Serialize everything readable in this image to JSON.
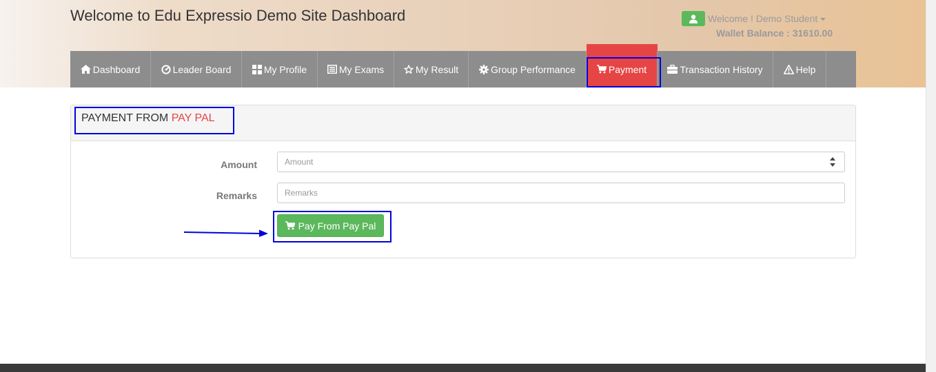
{
  "header": {
    "title": "Welcome to Edu Expressio Demo Site Dashboard",
    "welcome": "Welcome ! Demo Student",
    "wallet": "Wallet Balance : 31610.00"
  },
  "nav": {
    "items": [
      {
        "label": "Dashboard",
        "icon": "home-icon"
      },
      {
        "label": "Leader Board",
        "icon": "dashboard-gauge-icon"
      },
      {
        "label": "My Profile",
        "icon": "grid-icon"
      },
      {
        "label": "My Exams",
        "icon": "list-icon"
      },
      {
        "label": "My Result",
        "icon": "star-icon"
      },
      {
        "label": "Group Performance",
        "icon": "gear-icon"
      },
      {
        "label": "Payment",
        "icon": "cart-icon",
        "active": true
      },
      {
        "label": "Transaction History",
        "icon": "briefcase-icon"
      },
      {
        "label": "Help",
        "icon": "warning-icon"
      }
    ]
  },
  "panel": {
    "title_prefix": "PAYMENT FROM",
    "title_highlight": "PAY PAL",
    "amount_label": "Amount",
    "amount_placeholder": "Amount",
    "remarks_label": "Remarks",
    "remarks_placeholder": "Remarks",
    "button_label": "Pay From Pay Pal"
  },
  "colors": {
    "accent_red": "#e64545",
    "success_green": "#5cb85c",
    "nav_gray": "#8d8d8d",
    "highlight_blue": "#0000dd"
  }
}
